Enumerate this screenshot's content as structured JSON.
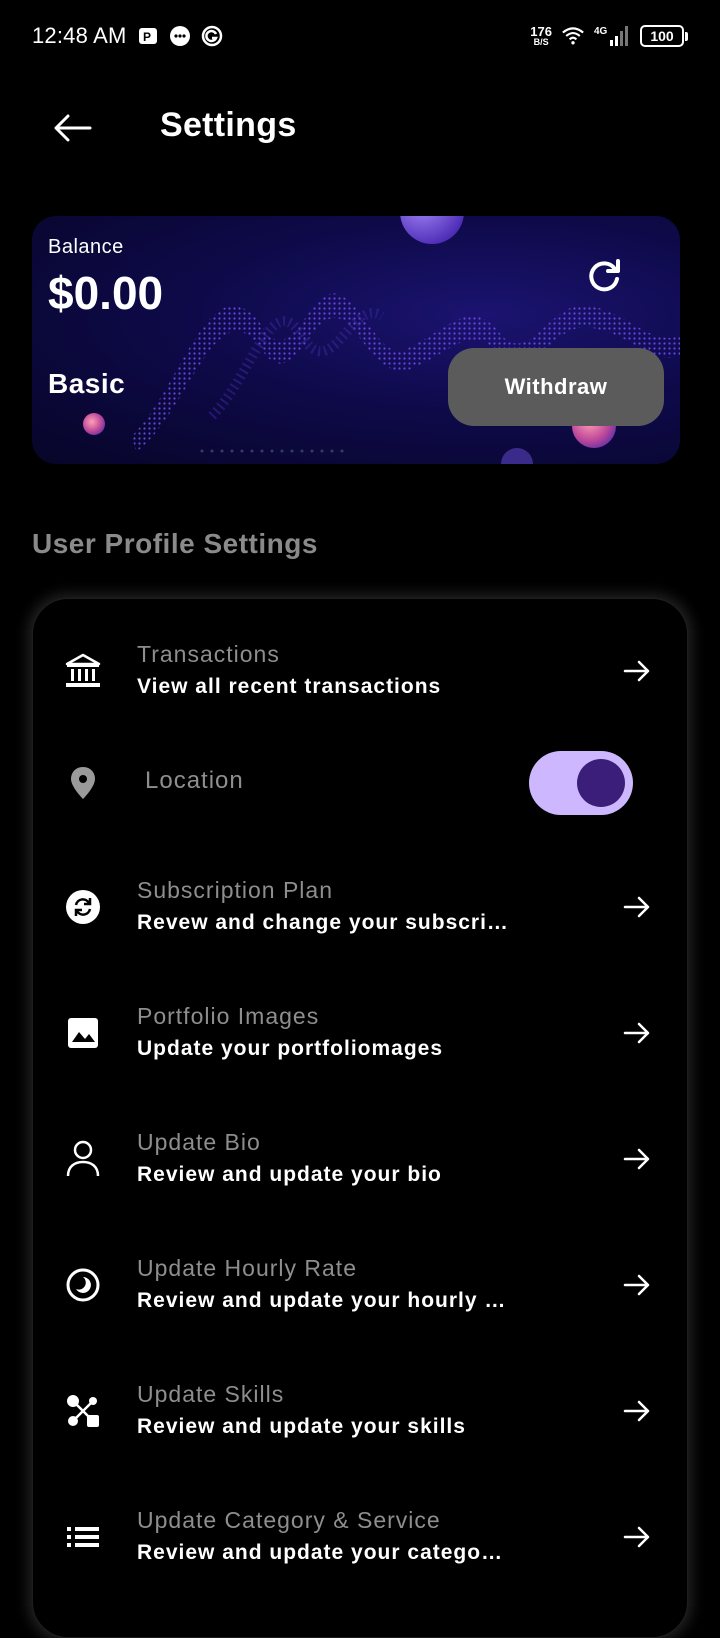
{
  "status_bar": {
    "time": "12:48 AM",
    "net_speed_value": "176",
    "net_speed_unit": "B/S",
    "network_type": "4G",
    "battery": "100"
  },
  "app_bar": {
    "title": "Settings"
  },
  "balance_card": {
    "label": "Balance",
    "amount": "$0.00",
    "plan": "Basic",
    "withdraw_label": "Withdraw"
  },
  "section_title": "User Profile Settings",
  "items": [
    {
      "title": "Transactions",
      "subtitle": "View all recent transactions",
      "icon": "bank-icon"
    },
    {
      "title": "Location",
      "icon": "location-pin-icon",
      "toggle_on": true
    },
    {
      "title": "Subscription Plan",
      "subtitle": "Revew and change your subscri…",
      "icon": "sync-icon"
    },
    {
      "title": "Portfolio Images",
      "subtitle": "Update your portfoliomages",
      "icon": "image-icon"
    },
    {
      "title": "Update Bio",
      "subtitle": "Review and update your bio",
      "icon": "person-icon"
    },
    {
      "title": "Update Hourly Rate",
      "subtitle": "Review and update your hourly …",
      "icon": "clock-icon"
    },
    {
      "title": "Update Skills",
      "subtitle": "Review and update your skills",
      "icon": "skills-icon"
    },
    {
      "title": "Update Category & Service",
      "subtitle": "Review and update your catego…",
      "icon": "list-icon"
    }
  ],
  "colors": {
    "background": "#000000",
    "card_gradient_dark": "#070528",
    "card_gradient_mid": "#1b1370",
    "toggle_track": "#cdb8ff",
    "toggle_knob": "#3b1e7a",
    "withdraw_button": "#5b5b5b",
    "muted_text": "#8e8e8e"
  }
}
